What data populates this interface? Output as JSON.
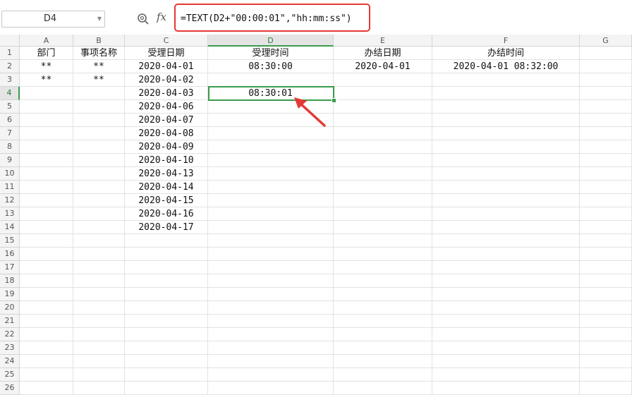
{
  "formula_bar": {
    "name_box": "D4",
    "fx_label": "fx",
    "formula": "=TEXT(D2+\"00:00:01\",\"hh:mm:ss\")"
  },
  "columns": [
    "A",
    "B",
    "C",
    "D",
    "E",
    "F",
    "G"
  ],
  "rows": [
    "1",
    "2",
    "3",
    "4",
    "5",
    "6",
    "7",
    "8",
    "9",
    "10",
    "11",
    "12",
    "13",
    "14",
    "15",
    "16",
    "17",
    "18",
    "19",
    "20",
    "21",
    "22",
    "23",
    "24",
    "25",
    "26"
  ],
  "active_cell": "D4",
  "cells": {
    "A1": "部门",
    "B1": "事项名称",
    "C1": "受理日期",
    "D1": "受理时间",
    "E1": "办结日期",
    "F1": "办结时间",
    "A2": "**",
    "B2": "**",
    "C2": "2020-04-01",
    "D2": "08:30:00",
    "E2": "2020-04-01",
    "F2": "2020-04-01 08:32:00",
    "A3": "**",
    "B3": "**",
    "C3": "2020-04-02",
    "C4": "2020-04-03",
    "D4": "08:30:01",
    "C5": "2020-04-06",
    "C6": "2020-04-07",
    "C7": "2020-04-08",
    "C8": "2020-04-09",
    "C9": "2020-04-10",
    "C10": "2020-04-13",
    "C11": "2020-04-14",
    "C12": "2020-04-15",
    "C13": "2020-04-16",
    "C14": "2020-04-17"
  },
  "colors": {
    "selection": "#3a9b4b",
    "annotation": "#e53935"
  },
  "icons": {
    "zoom": "zoom-formula-icon",
    "fx": "fx-icon",
    "dropdown": "chevron-down-icon"
  }
}
